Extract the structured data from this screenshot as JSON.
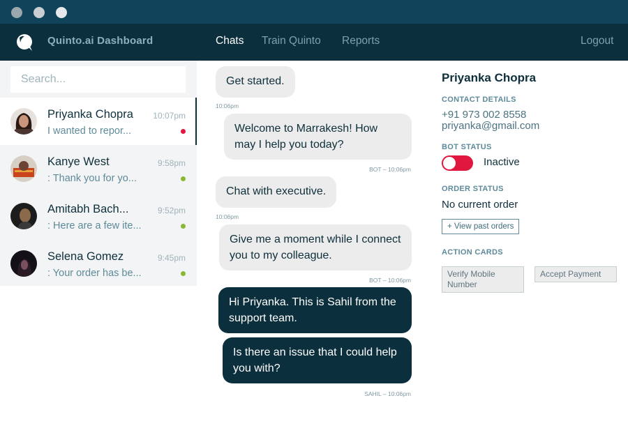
{
  "window": {
    "controls": [
      "close-dot",
      "minimize-dot",
      "maximize-dot"
    ]
  },
  "nav": {
    "brand": "Quinto.ai Dashboard",
    "links": [
      {
        "label": "Chats",
        "active": true
      },
      {
        "label": "Train Quinto",
        "active": false
      },
      {
        "label": "Reports",
        "active": false
      }
    ],
    "logout": "Logout"
  },
  "sidebar": {
    "search_placeholder": "Search...",
    "conversations": [
      {
        "name": "Priyanka Chopra",
        "time": "10:07pm",
        "preview": "I wanted to repor...",
        "status_color": "#e0173f",
        "active": true
      },
      {
        "name": "Kanye West",
        "time": "9:58pm",
        "preview": ": Thank you for yo...",
        "status_color": "#8ab833",
        "active": false
      },
      {
        "name": "Amitabh Bach...",
        "time": "9:52pm",
        "preview": ": Here are a few ite...",
        "status_color": "#8ab833",
        "active": false
      },
      {
        "name": "Selena Gomez",
        "time": "9:45pm",
        "preview": ": Your order has be...",
        "status_color": "#8ab833",
        "active": false
      }
    ]
  },
  "chat": {
    "messages": [
      {
        "from": "user",
        "text": "Get started.",
        "meta": "10:06pm"
      },
      {
        "from": "bot",
        "text": "Welcome to Marrakesh! How may I help you today?",
        "meta": "BOT – 10:06pm"
      },
      {
        "from": "user",
        "text": "Chat with executive.",
        "meta": "10:06pm"
      },
      {
        "from": "bot",
        "text": "Give me a moment while I connect you to my colleague.",
        "meta": "BOT – 10:06pm"
      },
      {
        "from": "agent",
        "text": "Hi Priyanka. This is Sahil from the support team.",
        "meta": ""
      },
      {
        "from": "agent",
        "text": "Is there an issue that I could help you with?",
        "meta": "SAHIL – 10:06pm"
      }
    ]
  },
  "contact": {
    "name": "Priyanka Chopra",
    "details_heading": "CONTACT DETAILS",
    "phone": "+91 973 002 8558",
    "email": "priyanka@gmail.com",
    "bot_status_heading": "BOT STATUS",
    "bot_status": "Inactive",
    "order_status_heading": "ORDER STATUS",
    "order_status": "No current order",
    "past_orders_button": "+ View past orders",
    "action_cards_heading": "ACTION CARDS",
    "action_cards": [
      "Verify Mobile Number",
      "Accept Payment"
    ]
  },
  "colors": {
    "titlebar": "#10445a",
    "navbar": "#0c2f3d",
    "agent_bubble": "#0c2f3d",
    "incoming_bubble": "#ececec",
    "status_unread": "#e0173f",
    "status_online": "#8ab833",
    "toggle_off": "#e0173f"
  }
}
